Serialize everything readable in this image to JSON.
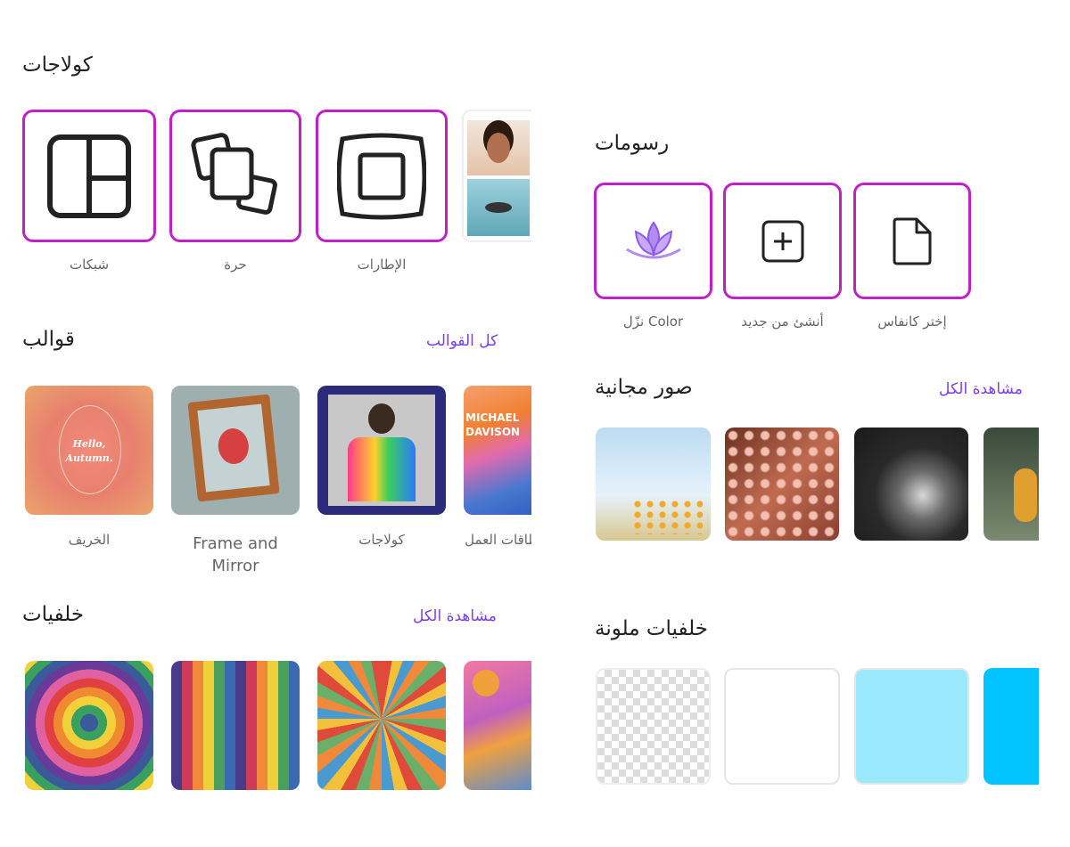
{
  "left": {
    "collages": {
      "title": "كولاجات",
      "items": [
        {
          "label": "شبكات",
          "icon": "grid-layout-icon"
        },
        {
          "label": "حرة",
          "icon": "freeform-icon"
        },
        {
          "label": "الإطارات",
          "icon": "frame-icon"
        }
      ]
    },
    "templates": {
      "title": "قوالب",
      "link": "كل القوالب",
      "items": [
        {
          "label": "الخريف",
          "text": "Hello, Autumn."
        },
        {
          "label": "Frame and Mirror"
        },
        {
          "label": "كولاجات"
        },
        {
          "label": "بطاقات العمل",
          "text": "MICHAEL DAVISON"
        }
      ]
    },
    "backgrounds": {
      "title": "خلفيات",
      "link": "مشاهدة الكل"
    }
  },
  "right": {
    "drawings": {
      "title": "رسومات",
      "items": [
        {
          "label": "نزّل Color",
          "icon": "lotus-icon"
        },
        {
          "label": "أنشئ من جديد",
          "icon": "plus-square-icon"
        },
        {
          "label": "إختر كانفاس",
          "icon": "file-icon"
        }
      ]
    },
    "photos": {
      "title": "صور مجانية",
      "link": "مشاهدة الكل"
    },
    "colors": {
      "title": "خلفيات ملونة",
      "swatches": [
        "transparent",
        "#ffffff",
        "#9be9ff",
        "#00c3ff"
      ]
    }
  },
  "accent": "#c21fcb",
  "link_color": "#7b3ff2"
}
